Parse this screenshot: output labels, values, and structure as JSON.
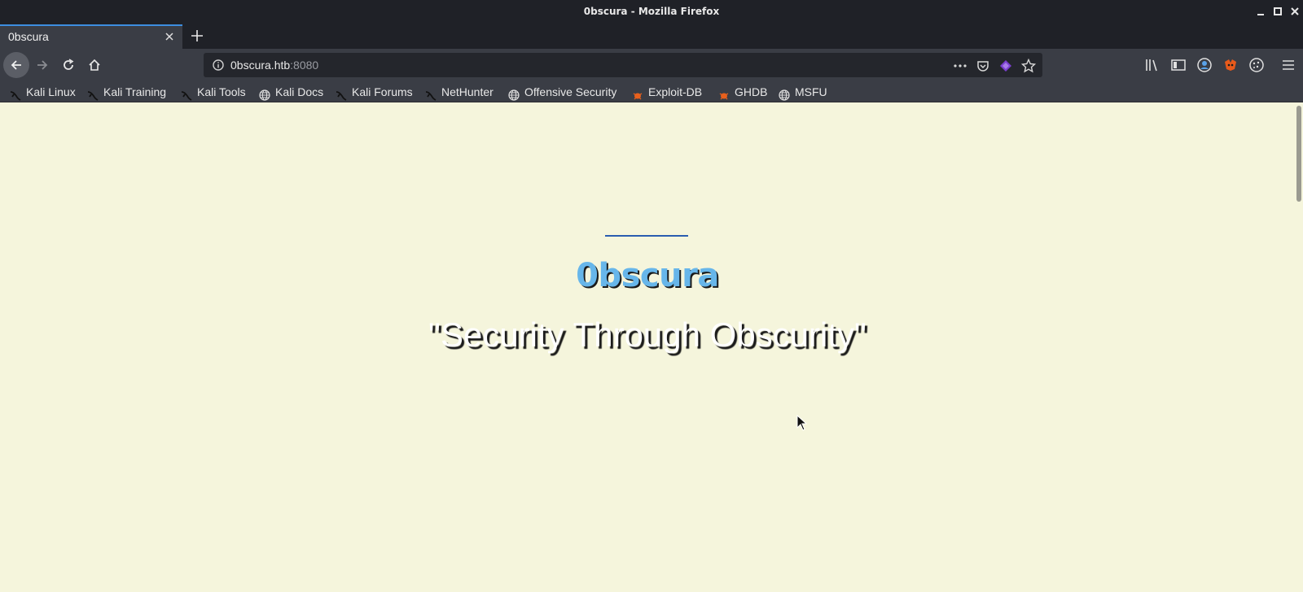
{
  "window": {
    "title": "0bscura - Mozilla Firefox"
  },
  "tab": {
    "label": "0bscura"
  },
  "urlbar": {
    "host": "0bscura.htb",
    "port": ":8080"
  },
  "bookmarks": [
    {
      "label": "Kali Linux",
      "icon": "kali-dragon-icon"
    },
    {
      "label": "Kali Training",
      "icon": "kali-dragon-icon"
    },
    {
      "label": "Kali Tools",
      "icon": "kali-dragon-icon"
    },
    {
      "label": "Kali Docs",
      "icon": "globe-icon"
    },
    {
      "label": "Kali Forums",
      "icon": "kali-dragon-icon"
    },
    {
      "label": "NetHunter",
      "icon": "kali-dragon-icon"
    },
    {
      "label": "Offensive Security",
      "icon": "globe-icon"
    },
    {
      "label": "Exploit-DB",
      "icon": "exploitdb-bug-icon"
    },
    {
      "label": "GHDB",
      "icon": "exploitdb-bug-icon"
    },
    {
      "label": "MSFU",
      "icon": "globe-icon"
    }
  ],
  "page": {
    "title": "0bscura",
    "tagline": "\"Security Through Obscurity\""
  },
  "colors": {
    "page_background": "#f5f5dc",
    "title": "#67b6ea",
    "divider": "#2a5db0",
    "tab_accent": "#3d8ee0"
  }
}
